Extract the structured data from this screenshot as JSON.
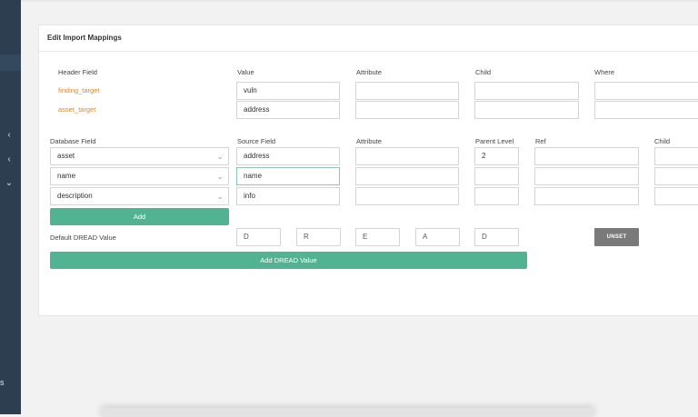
{
  "card": {
    "title": "Edit Import Mappings"
  },
  "header_section": {
    "columns": {
      "header_field": "Header Field",
      "value": "Value",
      "attribute": "Attribute",
      "child": "Child",
      "where": "Where"
    },
    "rows": [
      {
        "field": "finding_target",
        "value": "vuln"
      },
      {
        "field": "asset_target",
        "value": "address"
      }
    ]
  },
  "database_section": {
    "columns": {
      "database_field": "Database Field",
      "source_field": "Source Field",
      "attribute": "Attribute",
      "parent_level": "Parent Level",
      "ref": "Ref",
      "child": "Child"
    },
    "rows": [
      {
        "field": "asset",
        "source": "address",
        "parent_level": "2"
      },
      {
        "field": "name",
        "source": "name",
        "parent_level": ""
      },
      {
        "field": "description",
        "source": "info",
        "parent_level": ""
      }
    ],
    "add_label": "Add"
  },
  "dread": {
    "label": "Default DREAD Value",
    "placeholders": [
      "D",
      "R",
      "E",
      "A",
      "D"
    ],
    "unset_label": "UNSET",
    "add_label": "Add DREAD Value"
  },
  "sidebar": {
    "partial_label": "s"
  },
  "colors": {
    "accent": "#52b393",
    "link": "#d9862e",
    "sidebar": "#2c3e50"
  }
}
